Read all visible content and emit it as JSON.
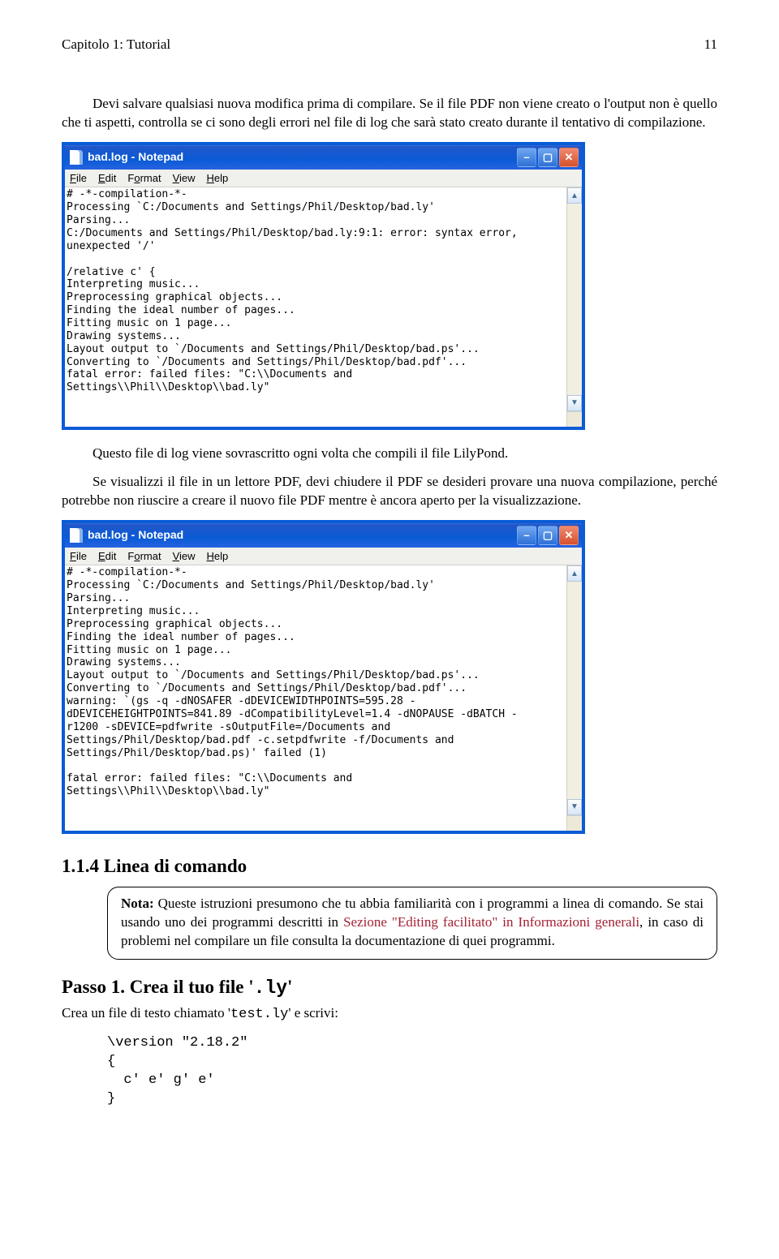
{
  "header": {
    "left": "Capitolo 1: Tutorial",
    "right": "11"
  },
  "para1": "Devi salvare qualsiasi nuova modifica prima di compilare. Se il file PDF non viene creato o l'output non è quello che ti aspetti, controlla se ci sono degli errori nel file di log che sarà stato creato durante il tentativo di compilazione.",
  "notepad1": {
    "title": "bad.log - Notepad",
    "menu": {
      "file": "File",
      "edit": "Edit",
      "format": "Format",
      "view": "View",
      "help": "Help"
    },
    "content": "# -*-compilation-*-\nProcessing `C:/Documents and Settings/Phil/Desktop/bad.ly'\nParsing...\nC:/Documents and Settings/Phil/Desktop/bad.ly:9:1: error: syntax error,\nunexpected '/'\n\n/relative c' {\nInterpreting music...\nPreprocessing graphical objects...\nFinding the ideal number of pages...\nFitting music on 1 page...\nDrawing systems...\nLayout output to `/Documents and Settings/Phil/Desktop/bad.ps'...\nConverting to `/Documents and Settings/Phil/Desktop/bad.pdf'...\nfatal error: failed files: \"C:\\\\Documents and\nSettings\\\\Phil\\\\Desktop\\\\bad.ly\""
  },
  "para2a": "Questo file di log viene sovrascritto ogni volta che compili il file LilyPond.",
  "para2b": "Se visualizzi il file in un lettore PDF, devi chiudere il PDF se desideri provare una nuova compilazione, perché potrebbe non riuscire a creare il nuovo file PDF mentre è ancora aperto per la visualizzazione.",
  "notepad2": {
    "title": "bad.log - Notepad",
    "menu": {
      "file": "File",
      "edit": "Edit",
      "format": "Format",
      "view": "View",
      "help": "Help"
    },
    "content": "# -*-compilation-*-\nProcessing `C:/Documents and Settings/Phil/Desktop/bad.ly'\nParsing...\nInterpreting music...\nPreprocessing graphical objects...\nFinding the ideal number of pages...\nFitting music on 1 page...\nDrawing systems...\nLayout output to `/Documents and Settings/Phil/Desktop/bad.ps'...\nConverting to `/Documents and Settings/Phil/Desktop/bad.pdf'...\nwarning: `(gs -q -dNOSAFER -dDEVICEWIDTHPOINTS=595.28 -\ndDEVICEHEIGHTPOINTS=841.89 -dCompatibilityLevel=1.4 -dNOPAUSE -dBATCH -\nr1200 -sDEVICE=pdfwrite -sOutputFile=/Documents and\nSettings/Phil/Desktop/bad.pdf -c.setpdfwrite -f/Documents and\nSettings/Phil/Desktop/bad.ps)' failed (1)\n\nfatal error: failed files: \"C:\\\\Documents and\nSettings\\\\Phil\\\\Desktop\\\\bad.ly\""
  },
  "section": "1.1.4 Linea di comando",
  "note": {
    "bold": "Nota:",
    "t1": " Queste istruzioni presumono che tu abbia familiarità con i programmi a linea di comando. Se stai usando uno dei programmi descritti in ",
    "link": "Sezione \"Editing facilitato\" in Informazioni generali",
    "t2": ", in caso di problemi nel compilare un file consulta la documentazione di quei programmi."
  },
  "step": {
    "prefix": "Passo 1. Crea il tuo file '",
    "mono": ".ly",
    "suffix": "'"
  },
  "step_body": {
    "t1": "Crea un file di testo chiamato '",
    "mono": "test.ly",
    "t2": "' e scrivi:"
  },
  "code": "\\version \"2.18.2\"\n{\n  c' e' g' e'\n}"
}
